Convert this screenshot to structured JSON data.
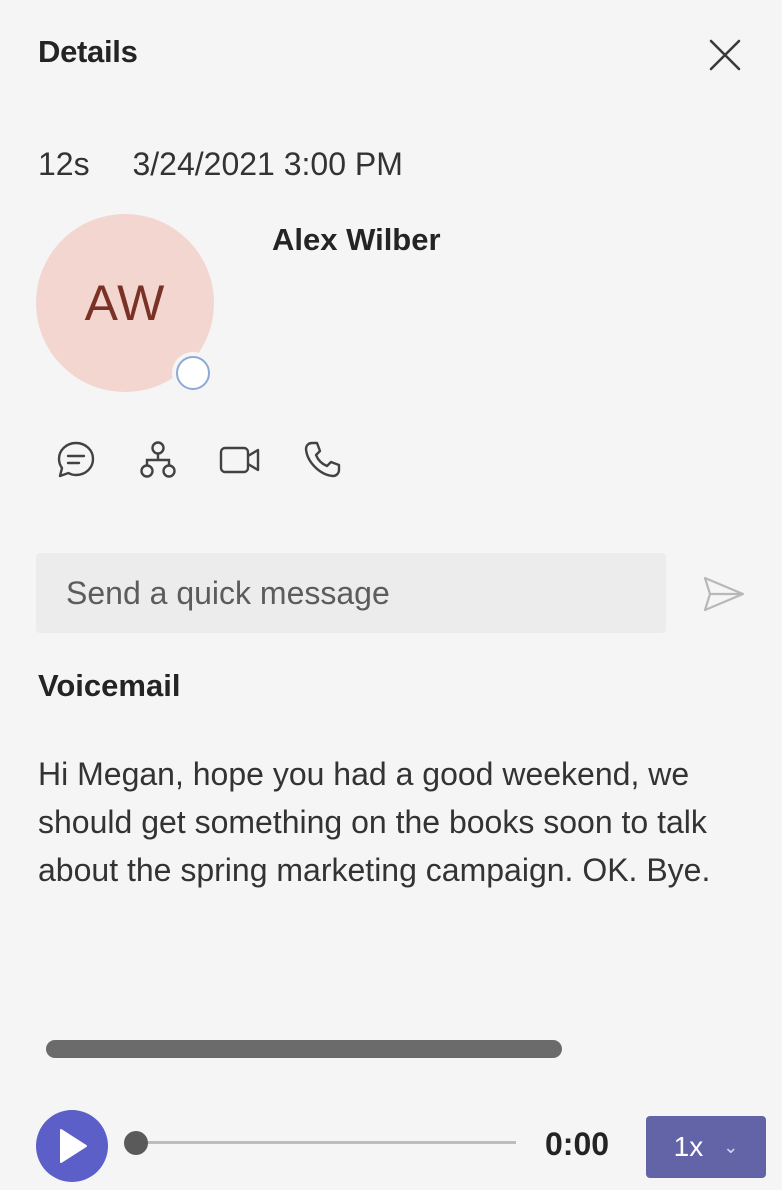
{
  "header": {
    "title": "Details",
    "close_icon": "close-icon"
  },
  "call": {
    "duration": "12s",
    "datetime": "3/24/2021 3:00 PM"
  },
  "contact": {
    "initials": "AW",
    "name": "Alex Wilber",
    "presence": "offline",
    "avatar_color": "#f3d6d0",
    "initials_color": "#7a3226"
  },
  "actions": [
    {
      "name": "chat",
      "icon": "chat-icon"
    },
    {
      "name": "org-chart",
      "icon": "org-chart-icon"
    },
    {
      "name": "video-call",
      "icon": "video-icon"
    },
    {
      "name": "audio-call",
      "icon": "phone-icon"
    }
  ],
  "quick_message": {
    "placeholder": "Send a quick message",
    "send_icon": "send-icon"
  },
  "voicemail": {
    "title": "Voicemail",
    "transcript": "Hi Megan, hope you had a good weekend, we should get something on the books soon to talk about the spring marketing campaign. OK. Bye."
  },
  "player": {
    "play_icon": "play-icon",
    "position_fraction": 0,
    "time": "0:00",
    "speed": "1x",
    "accent": "#5b5fc7"
  }
}
